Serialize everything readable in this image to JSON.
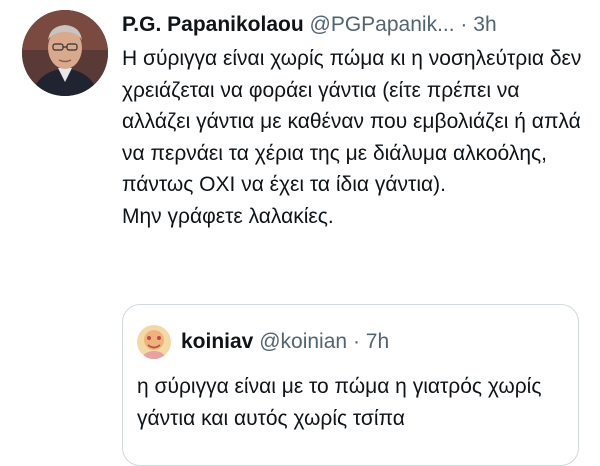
{
  "tweet": {
    "author_name": "P.G. Papanikolaou",
    "handle": "@PGPapanik...",
    "separator": "·",
    "time": "3h",
    "text": "Η σύριγγα είναι χωρίς πώμα κι η νοσηλεύτρια δεν χρειάζεται να φοράει γάντια (είτε πρέπει να αλλάζει γάντια με καθέναν που εμβολιάζει ή απλά να περνάει τα χέρια της με διάλυμα αλκοόλης, πάντως ΟΧΙ να έχει τα ίδια γάντια).\nΜην γράφετε λαλακίες."
  },
  "quoted_tweet": {
    "author_name": "koiniav",
    "handle": "@koinian",
    "separator": "·",
    "time": "7h",
    "text": "η σύριγγα είναι με το πώμα η γιατρός χωρίς γάντια και αυτός χωρίς τσίπα"
  },
  "colors": {
    "text": "#0f1419",
    "secondary": "#536471",
    "border": "#cfd9de"
  }
}
